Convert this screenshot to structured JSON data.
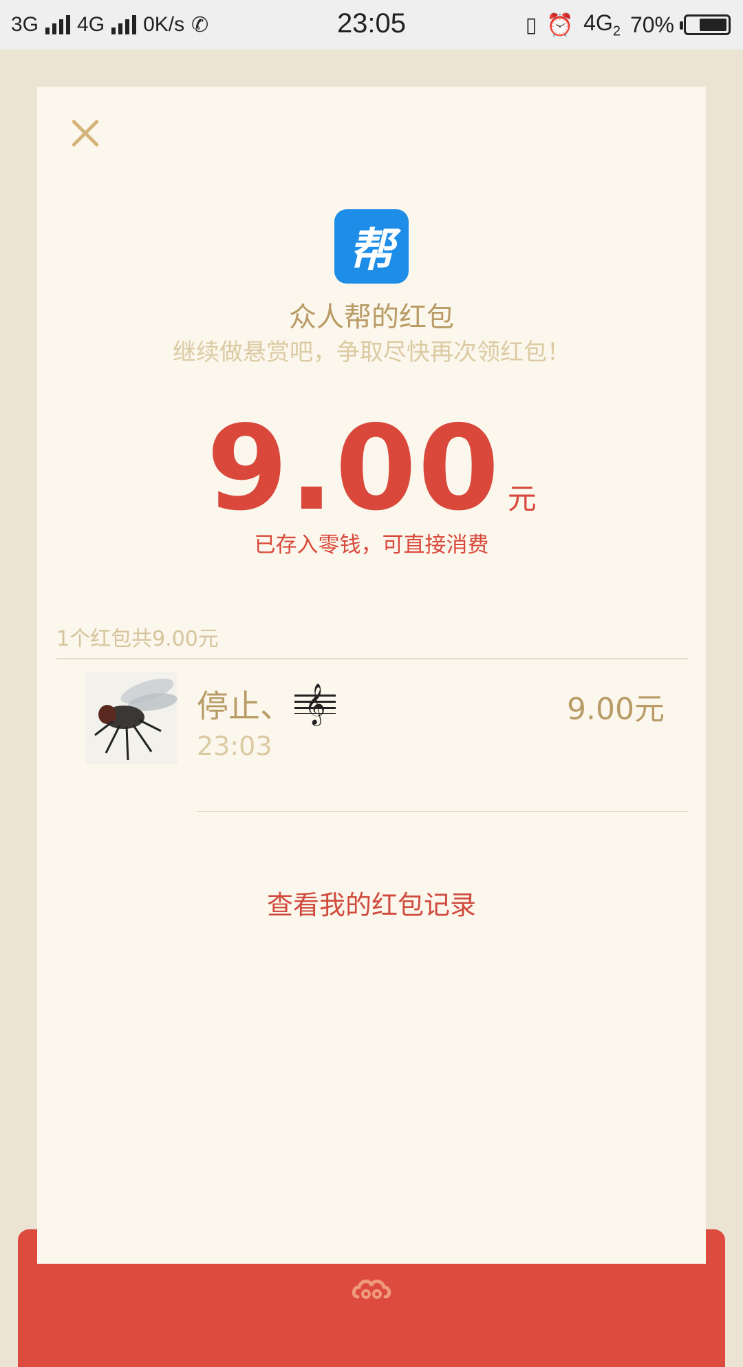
{
  "status_bar": {
    "net1": "3G",
    "net2": "4G",
    "speed": "0K/s",
    "time": "23:05",
    "net3": "4G",
    "net3_sub": "2",
    "battery": "70%",
    "battery_level": 0.7
  },
  "header": {
    "logo_char": "帮",
    "sender_name": "众人帮的红包",
    "subtitle": "继续做悬赏吧，争取尽快再次领红包！"
  },
  "amount": {
    "value": "9.00",
    "unit": "元",
    "note": "已存入零钱，可直接消费"
  },
  "summary": "1个红包共9.00元",
  "records": [
    {
      "name": "停止、",
      "time": "23:03",
      "amount": "9.00元"
    }
  ],
  "footer_link": "查看我的红包记录",
  "colors": {
    "accent_red": "#d9483b",
    "gold_text": "#b89b65",
    "card_bg": "#fbf7ec",
    "logo_blue": "#1d8de8"
  }
}
